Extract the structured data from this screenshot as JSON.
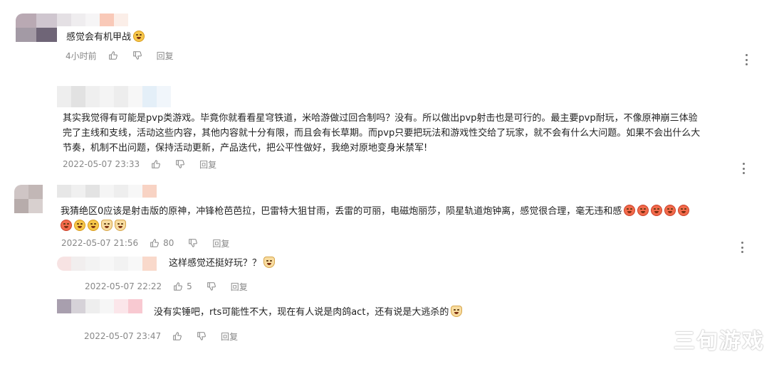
{
  "comments": [
    {
      "text_lines": [
        "感觉会有机甲战"
      ],
      "emojis": [
        "smile"
      ],
      "time": "4小时前",
      "reply_label": "回复"
    },
    {
      "text_lines": [
        "其实我觉得有可能是pvp类游戏。毕竟你就看看星穹铁道，米哈游做过回合制吗？没有。所以做出pvp射击也是可行的。最主要pvp耐玩，不像原神崩三体验",
        "完了主线和支线，活动这些内容，其他内容就十分有限，而且会有长草期。而pvp只要把玩法和游戏性交给了玩家，就不会有什么大问题。如果不会出什么大",
        "节奏，机制不出问题，保持活动更新，产品迭代，把公平性做好，我绝对原地变身米禁军!"
      ],
      "time": "2022-05-07 23:33",
      "reply_label": "回复"
    },
    {
      "text_lines": [
        "我猜绝区0应该是射击版的原神，冲锋枪芭芭拉，巴雷特大狙甘雨，丢雷的可丽，电磁炮丽莎，陨星轨道炮钟离，感觉很合理，毫无违和感"
      ],
      "emojis_line1": [
        "heart-eyes",
        "heart-eyes",
        "laugh",
        "laugh",
        "heart-eyes"
      ],
      "emojis_line2": [
        "heart-eyes",
        "smile",
        "smile",
        "cat",
        "cat"
      ],
      "time": "2022-05-07 21:56",
      "likes": "80",
      "reply_label": "回复"
    }
  ],
  "replies": [
    {
      "text": "这样感觉还挺好玩？？",
      "emojis": [
        "cat"
      ],
      "time": "2022-05-07 22:22",
      "likes": "5",
      "reply_label": "回复"
    },
    {
      "text": "没有实锤吧，rts可能性不大，现在有人说是肉鸽act，还有说是大逃杀的",
      "emojis": [
        "cat"
      ],
      "time": "2022-05-07 23:47",
      "reply_label": "回复"
    }
  ],
  "watermark": "三旬游戏",
  "colors": {
    "text": "#222222",
    "meta": "#888888",
    "background": "#ffffff"
  }
}
